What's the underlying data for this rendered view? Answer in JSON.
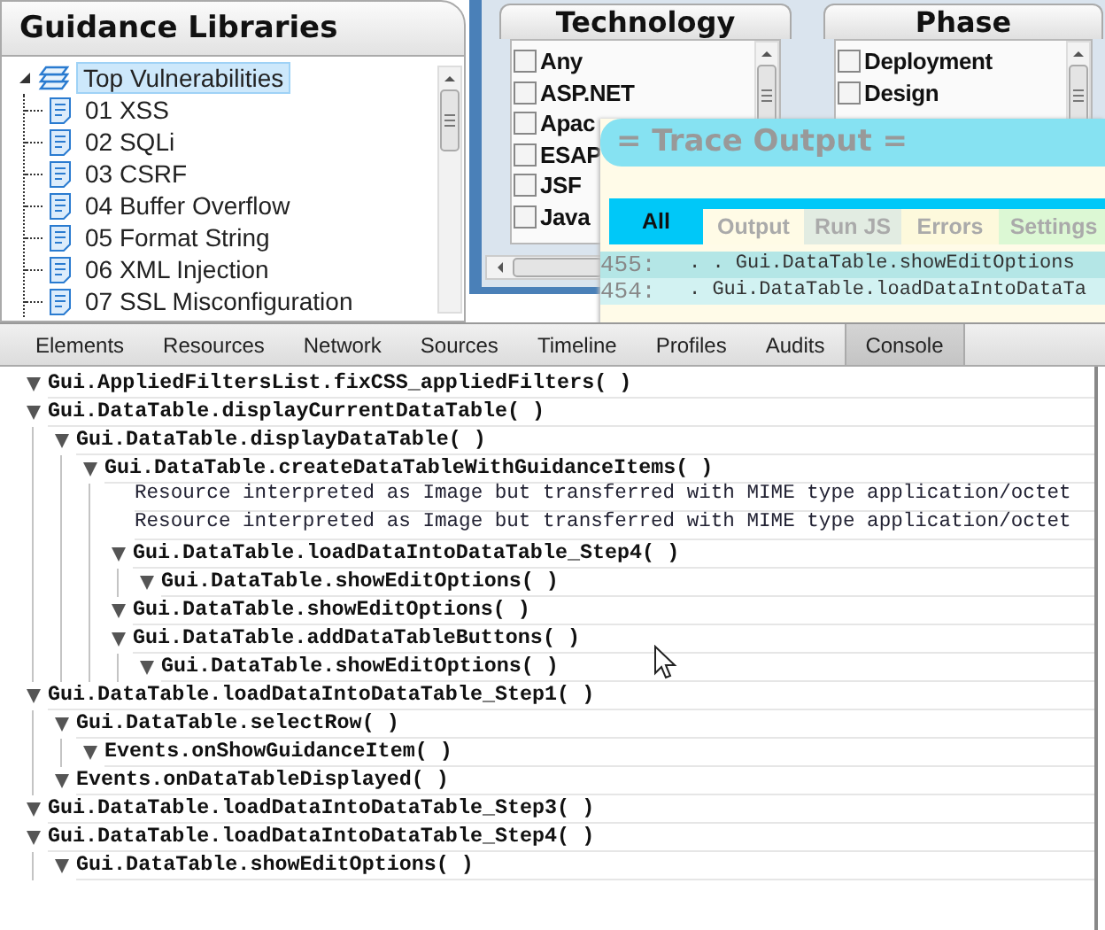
{
  "guidance_libraries": {
    "title": "Guidance Libraries",
    "tree": [
      {
        "label": "Top Vulnerabilities",
        "expanded": true,
        "selected": true,
        "children": [
          {
            "label": "01 XSS"
          },
          {
            "label": "02 SQLi"
          },
          {
            "label": "03 CSRF"
          },
          {
            "label": "04 Buffer Overflow"
          },
          {
            "label": "05 Format String"
          },
          {
            "label": "06 XML Injection"
          },
          {
            "label": "07 SSL Misconfiguration"
          }
        ]
      }
    ]
  },
  "filters": [
    {
      "title": "Technology",
      "items": [
        {
          "label": "Any",
          "checked": false
        },
        {
          "label": "ASP.NET",
          "checked": false
        },
        {
          "label": "Apac",
          "checked": false
        },
        {
          "label": "ESAP",
          "checked": false
        },
        {
          "label": "JSF",
          "checked": false
        },
        {
          "label": "Java",
          "checked": false
        }
      ]
    },
    {
      "title": "Phase",
      "items": [
        {
          "label": "Deployment",
          "checked": false
        },
        {
          "label": "Design",
          "checked": false
        }
      ]
    }
  ],
  "trace_output": {
    "title": "= Trace Output =",
    "tabs": [
      {
        "label": "All",
        "selected": true,
        "color": "#00c8f8"
      },
      {
        "label": "Output",
        "selected": false,
        "color": "#fffbe6"
      },
      {
        "label": "Run JS",
        "selected": false,
        "color": "#e2ece2"
      },
      {
        "label": "Errors",
        "selected": false,
        "color": "#fdf9dc"
      },
      {
        "label": "Settings",
        "selected": false,
        "color": "#dcf8d4"
      }
    ],
    "lines": [
      {
        "number": "455:",
        "text": ". . Gui.DataTable.showEditOptions"
      },
      {
        "number": "454:",
        "text": ". Gui.DataTable.loadDataIntoDataTa"
      }
    ]
  },
  "devtools": {
    "tabs": [
      {
        "label": "Elements",
        "selected": false
      },
      {
        "label": "Resources",
        "selected": false
      },
      {
        "label": "Network",
        "selected": false
      },
      {
        "label": "Sources",
        "selected": false
      },
      {
        "label": "Timeline",
        "selected": false
      },
      {
        "label": "Profiles",
        "selected": false
      },
      {
        "label": "Audits",
        "selected": false
      },
      {
        "label": "Console",
        "selected": true
      }
    ],
    "console": [
      {
        "kind": "group",
        "text": "Gui.AppliedFiltersList.fixCSS_appliedFilters( )",
        "expanded": true
      },
      {
        "kind": "group",
        "text": "Gui.DataTable.displayCurrentDataTable( )",
        "expanded": true,
        "children": [
          {
            "kind": "group",
            "text": "Gui.DataTable.displayDataTable( )",
            "expanded": true,
            "children": [
              {
                "kind": "group",
                "text": "Gui.DataTable.createDataTableWithGuidanceItems( )",
                "expanded": true,
                "children": [
                  {
                    "kind": "message",
                    "text": "Resource interpreted as Image but transferred with MIME type application/octet"
                  },
                  {
                    "kind": "message",
                    "text": "Resource interpreted as Image but transferred with MIME type application/octet"
                  },
                  {
                    "kind": "group",
                    "text": "Gui.DataTable.loadDataIntoDataTable_Step4( )",
                    "expanded": true,
                    "children": [
                      {
                        "kind": "group",
                        "text": "Gui.DataTable.showEditOptions( )",
                        "expanded": true
                      }
                    ]
                  },
                  {
                    "kind": "group",
                    "text": "Gui.DataTable.showEditOptions( )",
                    "expanded": true
                  },
                  {
                    "kind": "group",
                    "text": "Gui.DataTable.addDataTableButtons( )",
                    "expanded": true,
                    "children": [
                      {
                        "kind": "group",
                        "text": "Gui.DataTable.showEditOptions( )",
                        "expanded": true
                      }
                    ]
                  }
                ]
              }
            ]
          }
        ]
      },
      {
        "kind": "group",
        "text": "Gui.DataTable.loadDataIntoDataTable_Step1( )",
        "expanded": true,
        "children": [
          {
            "kind": "group",
            "text": "Gui.DataTable.selectRow( )",
            "expanded": true,
            "children": [
              {
                "kind": "group",
                "text": "Events.onShowGuidanceItem( )",
                "expanded": true
              }
            ]
          },
          {
            "kind": "group",
            "text": "Events.onDataTableDisplayed( )",
            "expanded": true
          }
        ]
      },
      {
        "kind": "group",
        "text": "Gui.DataTable.loadDataIntoDataTable_Step3( )",
        "expanded": true
      },
      {
        "kind": "group",
        "text": "Gui.DataTable.loadDataIntoDataTable_Step4( )",
        "expanded": true,
        "children": [
          {
            "kind": "group",
            "text": "Gui.DataTable.showEditOptions( )",
            "expanded": true
          }
        ]
      }
    ]
  }
}
